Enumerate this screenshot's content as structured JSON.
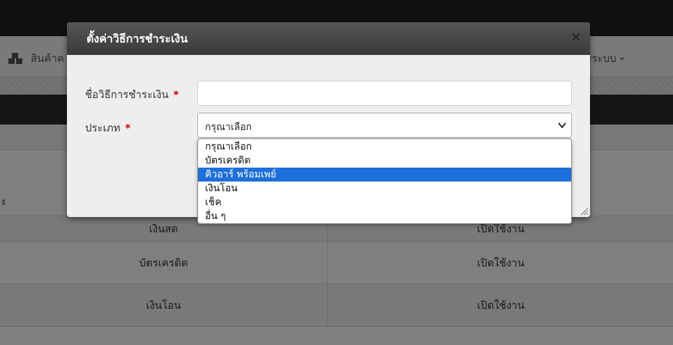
{
  "navbar": {
    "left_item_label": "สินค้าค",
    "right_item_label": "ารระบบ"
  },
  "table": {
    "rows": [
      {
        "name": "เงินสด",
        "status": "เปิดใช้งาน"
      },
      {
        "name": "บัตรเครดิต",
        "status": "เปิดใช้งาน"
      },
      {
        "name": "เงินโอน",
        "status": "เปิดใช้งาน"
      }
    ]
  },
  "modal": {
    "title": "ตั้งค่าวิธีการชำระเงิน",
    "close_label": "×",
    "name_label": "ชื่อวิธีการชำระเงิน",
    "name_value": "",
    "type_label": "ประเภท",
    "required_mark": "*",
    "type_selected": "กรุณาเลือก",
    "options": [
      "กรุณาเลือก",
      "บัตรเครดิต",
      "คิวอาร์ พร้อมเพย์",
      "เงินโอน",
      "เช็ค",
      "อื่น ๆ"
    ],
    "highlighted_option_index": 2
  },
  "colors": {
    "highlight": "#1e6fd9",
    "required": "#cc0000",
    "modal_header": "#3a3a3a"
  }
}
